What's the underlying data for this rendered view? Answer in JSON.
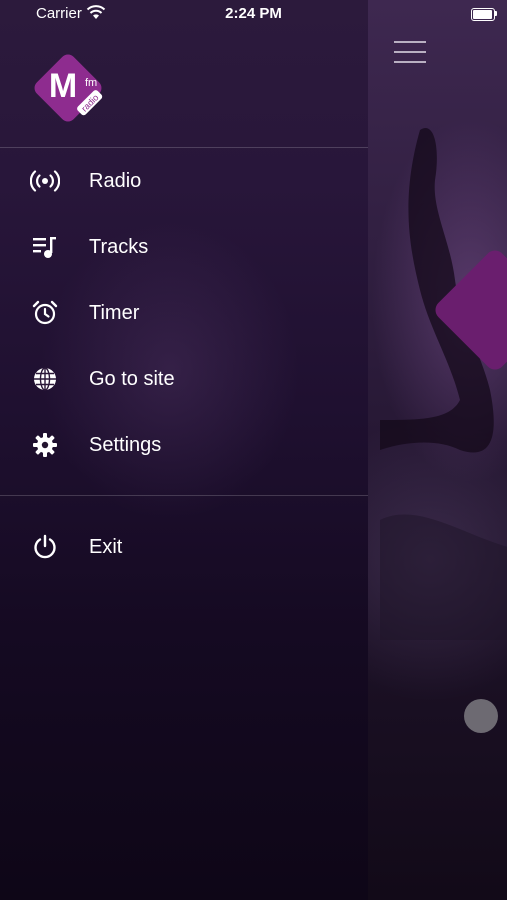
{
  "status_bar": {
    "carrier": "Carrier",
    "time": "2:24 PM"
  },
  "drawer": {
    "logo": {
      "letter": "M",
      "sup": "fm",
      "badge": "radio"
    },
    "items": [
      {
        "label": "Radio",
        "icon": "radio-broadcast-icon"
      },
      {
        "label": "Tracks",
        "icon": "playlist-icon"
      },
      {
        "label": "Timer",
        "icon": "alarm-clock-icon"
      },
      {
        "label": "Go to site",
        "icon": "globe-icon"
      },
      {
        "label": "Settings",
        "icon": "gear-icon"
      }
    ],
    "exit": {
      "label": "Exit",
      "icon": "power-icon"
    }
  },
  "colors": {
    "accent": "#7b2a7f",
    "drawer_bg": "#231330",
    "text": "#ffffff"
  }
}
